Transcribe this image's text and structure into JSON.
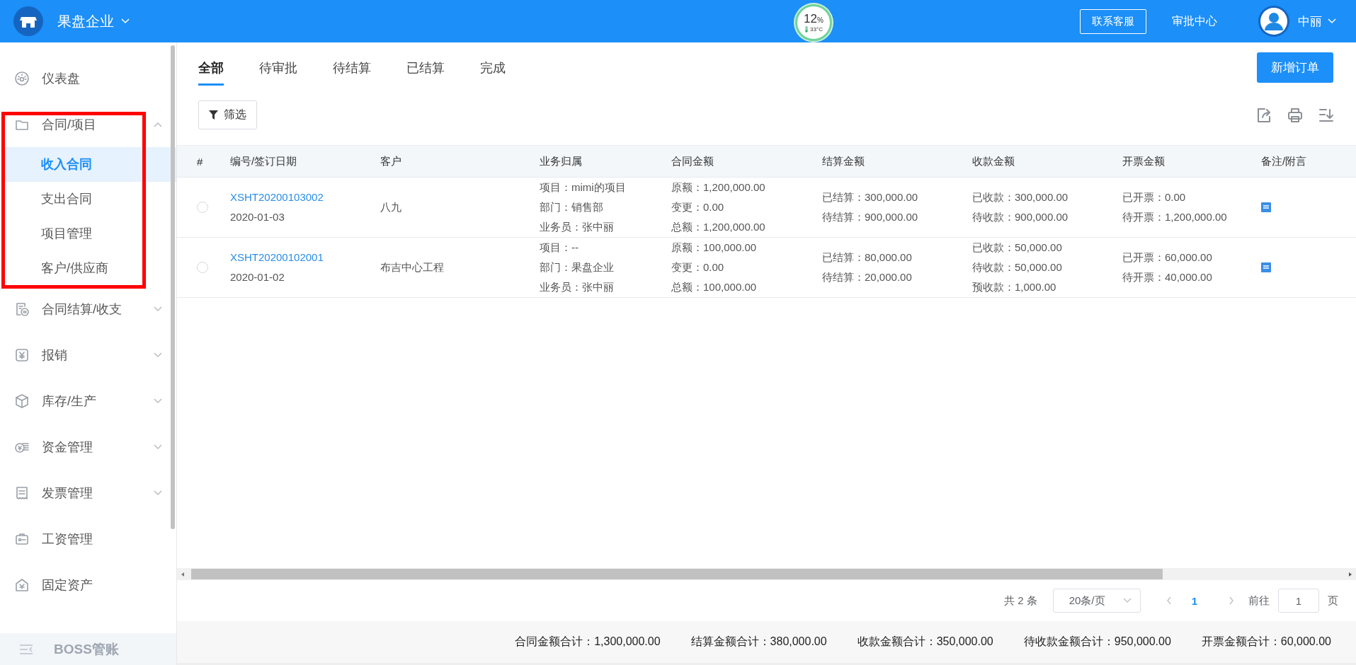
{
  "header": {
    "company": "果盘企业",
    "gauge": {
      "value": "12",
      "unit": "%",
      "temperature": "33°C"
    },
    "service_button": "联系客服",
    "approval_link": "审批中心",
    "user_name": "中丽"
  },
  "sidebar": {
    "items": [
      {
        "label": "仪表盘",
        "kind": "link"
      },
      {
        "label": "合同/项目",
        "kind": "group",
        "expanded": true,
        "highlighted": true,
        "children": [
          {
            "label": "收入合同",
            "selected": true
          },
          {
            "label": "支出合同",
            "selected": false
          },
          {
            "label": "项目管理",
            "selected": false
          },
          {
            "label": "客户/供应商",
            "selected": false
          }
        ]
      },
      {
        "label": "合同结算/收支",
        "kind": "group",
        "expanded": false,
        "highlighted": false
      },
      {
        "label": "报销",
        "kind": "group",
        "expanded": false,
        "highlighted": false
      },
      {
        "label": "库存/生产",
        "kind": "group",
        "expanded": false,
        "highlighted": false
      },
      {
        "label": "资金管理",
        "kind": "group",
        "expanded": false,
        "highlighted": false
      },
      {
        "label": "发票管理",
        "kind": "group",
        "expanded": false,
        "highlighted": false
      },
      {
        "label": "工资管理",
        "kind": "link"
      },
      {
        "label": "固定资产",
        "kind": "link"
      }
    ],
    "footer": "BOSS管账"
  },
  "tabs": [
    {
      "label": "全部",
      "selected": true
    },
    {
      "label": "待审批",
      "selected": false
    },
    {
      "label": "待结算",
      "selected": false
    },
    {
      "label": "已结算",
      "selected": false
    },
    {
      "label": "完成",
      "selected": false
    }
  ],
  "new_button": "新增订单",
  "filter_button": "筛选",
  "table": {
    "columns": [
      "#",
      "编号/签订日期",
      "客户",
      "业务归属",
      "合同金额",
      "结算金额",
      "收款金额",
      "开票金额",
      "备注/附言"
    ],
    "rows": [
      {
        "selected": false,
        "number": "XSHT20200103002",
        "date": "2020-01-03",
        "customer": "八九",
        "business": [
          "项目：mimi的项目",
          "部门：销售部",
          "业务员：张中丽"
        ],
        "contract_amount": [
          "原额：1,200,000.00",
          "变更：0.00",
          "总额：1,200,000.00"
        ],
        "settlement": [
          "已结算：300,000.00",
          "待结算：900,000.00"
        ],
        "receipt": [
          "已收款：300,000.00",
          "待收款：900,000.00"
        ],
        "invoice": [
          "已开票：0.00",
          "待开票：1,200,000.00"
        ]
      },
      {
        "selected": false,
        "number": "XSHT20200102001",
        "date": "2020-01-02",
        "customer": "布吉中心工程",
        "business": [
          "项目：--",
          "部门：果盘企业",
          "业务员：张中丽"
        ],
        "contract_amount": [
          "原额：100,000.00",
          "变更：0.00",
          "总额：100,000.00"
        ],
        "settlement": [
          "已结算：80,000.00",
          "待结算：20,000.00"
        ],
        "receipt": [
          "已收款：50,000.00",
          "待收款：50,000.00",
          "预收款：1,000.00"
        ],
        "invoice": [
          "已开票：60,000.00",
          "待开票：40,000.00"
        ]
      }
    ]
  },
  "pagination": {
    "total": "共 2 条",
    "page_size": "20条/页",
    "pages": [
      {
        "label": "1",
        "selected": true
      }
    ],
    "goto_label": "前往",
    "goto_value": "1",
    "goto_suffix": "页"
  },
  "totals": [
    "合同金额合计：1,300,000.00",
    "结算金额合计：380,000.00",
    "收款金额合计：350,000.00",
    "待收款金额合计：950,000.00",
    "开票金额合计：60,000.00"
  ]
}
